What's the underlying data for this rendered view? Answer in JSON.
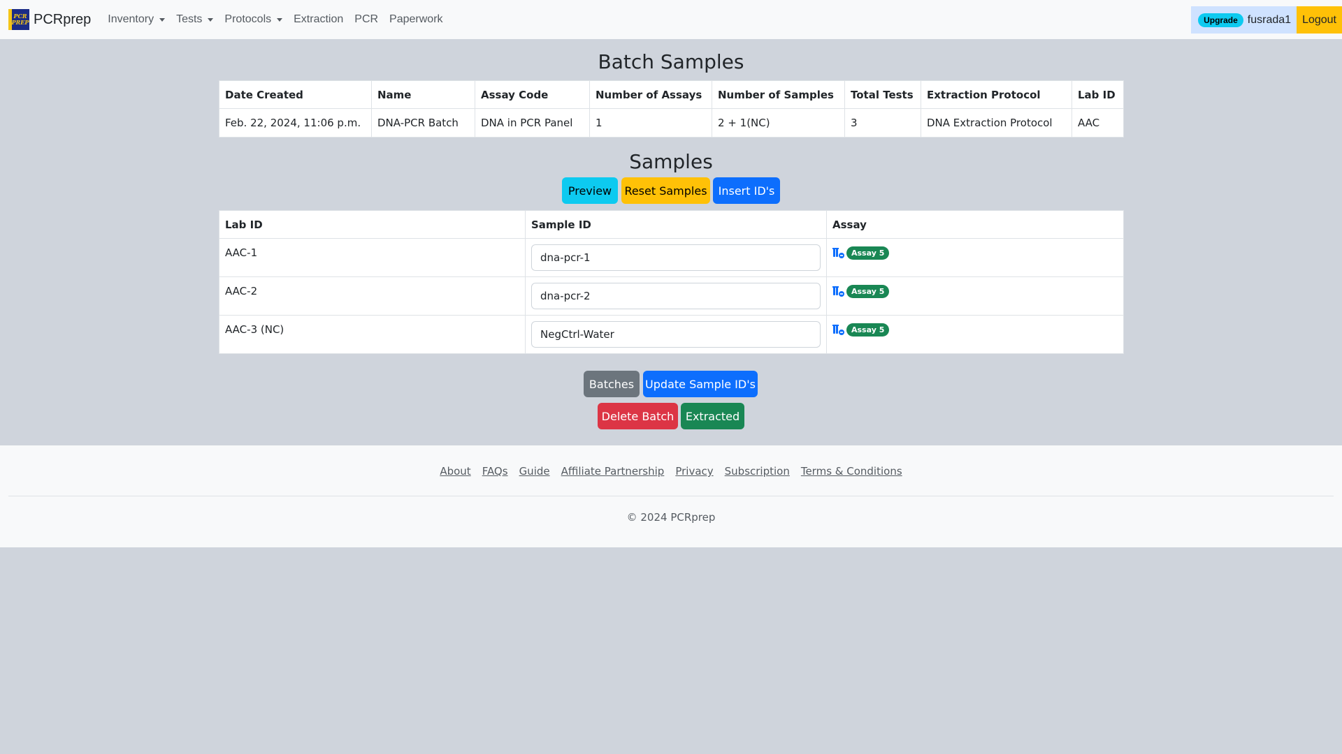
{
  "brand": {
    "logo_text": "PCR PREP",
    "name": "PCRprep"
  },
  "nav": {
    "items": [
      {
        "label": "Inventory",
        "dropdown": true
      },
      {
        "label": "Tests",
        "dropdown": true
      },
      {
        "label": "Protocols",
        "dropdown": true
      },
      {
        "label": "Extraction",
        "dropdown": false
      },
      {
        "label": "PCR",
        "dropdown": false
      },
      {
        "label": "Paperwork",
        "dropdown": false
      }
    ],
    "upgrade": "Upgrade",
    "username": "fusrada1",
    "logout": "Logout"
  },
  "batch": {
    "title": "Batch Samples",
    "headers": [
      "Date Created",
      "Name",
      "Assay Code",
      "Number of Assays",
      "Number of Samples",
      "Total Tests",
      "Extraction Protocol",
      "Lab ID"
    ],
    "row": [
      "Feb. 22, 2024, 11:06 p.m.",
      "DNA-PCR Batch",
      "DNA in PCR Panel",
      "1",
      "2 + 1(NC)",
      "3",
      "DNA Extraction Protocol",
      "AAC"
    ]
  },
  "samples": {
    "title": "Samples",
    "buttons": {
      "preview": "Preview",
      "reset": "Reset Samples",
      "insert": "Insert ID's"
    },
    "headers": [
      "Lab ID",
      "Sample ID",
      "Assay"
    ],
    "rows": [
      {
        "lab_id": "AAC-1",
        "sample_id": "dna-pcr-1",
        "assay": "Assay 5"
      },
      {
        "lab_id": "AAC-2",
        "sample_id": "dna-pcr-2",
        "assay": "Assay 5"
      },
      {
        "lab_id": "AAC-3 (NC)",
        "sample_id": "NegCtrl-Water",
        "assay": "Assay 5"
      }
    ]
  },
  "actions": {
    "batches": "Batches",
    "update": "Update Sample ID's",
    "delete": "Delete Batch",
    "extracted": "Extracted"
  },
  "footer": {
    "links": [
      "About",
      "FAQs",
      "Guide",
      "Affiliate Partnership",
      "Privacy",
      "Subscription",
      "Terms & Conditions"
    ],
    "copyright": "© 2024 PCRprep"
  },
  "colors": {
    "page_bg": "#cfd4dc",
    "primary": "#0d6efd",
    "info": "#0dcaf0",
    "warning": "#ffc107",
    "success": "#198754",
    "danger": "#dc3545",
    "secondary": "#6c757d"
  }
}
